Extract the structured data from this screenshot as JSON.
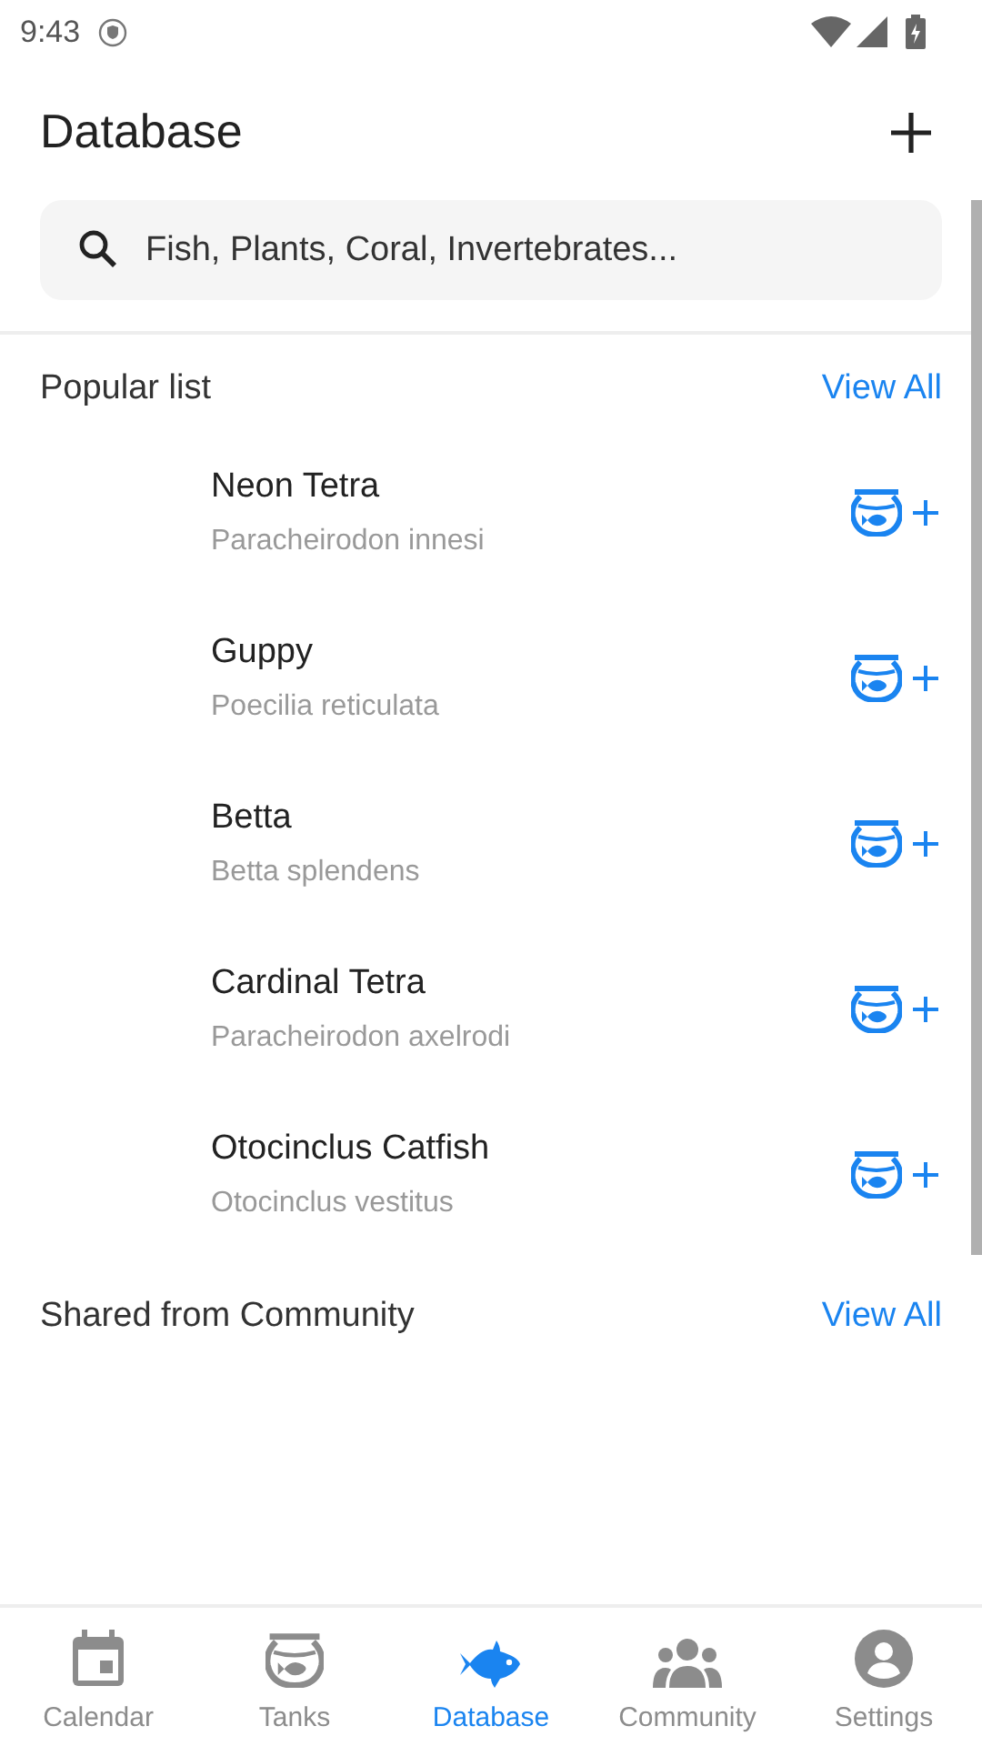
{
  "status_bar": {
    "time": "9:43"
  },
  "header": {
    "title": "Database"
  },
  "search": {
    "placeholder": "Fish, Plants, Coral, Invertebrates..."
  },
  "popular": {
    "title": "Popular list",
    "link": "View All",
    "items": [
      {
        "name": "Neon Tetra",
        "scientific": "Paracheirodon innesi"
      },
      {
        "name": "Guppy",
        "scientific": "Poecilia reticulata"
      },
      {
        "name": "Betta",
        "scientific": "Betta splendens"
      },
      {
        "name": "Cardinal Tetra",
        "scientific": "Paracheirodon axelrodi"
      },
      {
        "name": "Otocinclus Catfish",
        "scientific": "Otocinclus vestitus"
      }
    ]
  },
  "community": {
    "title": "Shared from Community",
    "link": "View All"
  },
  "nav": [
    {
      "kind": "calendar",
      "label": "Calendar",
      "selected": false
    },
    {
      "kind": "tanks",
      "label": "Tanks",
      "selected": false
    },
    {
      "kind": "database",
      "label": "Database",
      "selected": true
    },
    {
      "kind": "community",
      "label": "Community",
      "selected": false
    },
    {
      "kind": "settings",
      "label": "Settings",
      "selected": false
    }
  ]
}
